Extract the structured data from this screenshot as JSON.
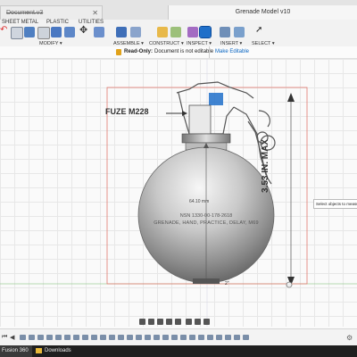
{
  "tabs": {
    "document_tab": "Document.v3",
    "active_tab": "Grenade Model v10"
  },
  "ribbon": {
    "tabs": [
      "SHEET METAL",
      "PLASTIC",
      "UTILITIES"
    ],
    "groups": [
      "MODIFY ▾",
      "ASSEMBLE ▾",
      "CONSTRUCT ▾",
      "INSPECT ▾",
      "INSERT ▾",
      "SELECT ▾"
    ]
  },
  "banner": {
    "label": "Read-Only:",
    "message": "Document is not editable",
    "action": "Make Editable"
  },
  "drawing": {
    "fuze_label": "FUZE M228",
    "height_dim": "3.53 IN. MAX",
    "diameter_note": "64.10 mm",
    "body_line1": "NSN 1330-00-178-2618",
    "body_line2": "GRENADE, HAND, PRACTICE, DELAY, M69",
    "bottom_dim": "2\""
  },
  "tooltip": "Select objects to measure",
  "taskbar": {
    "app": "Fusion 360",
    "item": "Downloads"
  },
  "colors": {
    "ribbon_bg": "#f2f2f2",
    "accent": "#0a66c2",
    "readonly_icon": "#e1a21a",
    "sketch_rect": "#e07a6f",
    "taskbar_bg": "#1f1f1f"
  }
}
